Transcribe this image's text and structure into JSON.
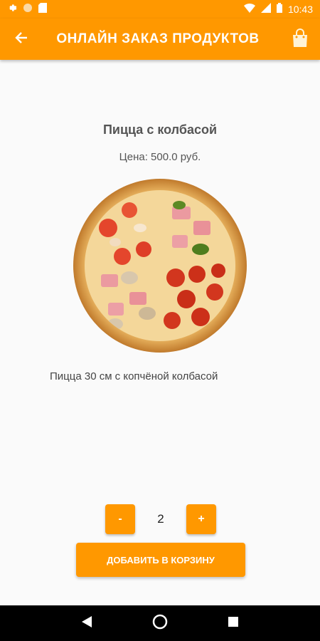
{
  "status_bar": {
    "time": "10:43",
    "icons": [
      "settings-icon",
      "circle-icon",
      "sd-card-icon",
      "wifi-icon",
      "signal-icon",
      "battery-icon"
    ]
  },
  "app_bar": {
    "title": "ОНЛАЙН ЗАКАЗ ПРОДУКТОВ",
    "back_icon": "arrow-back-icon",
    "cart_icon": "shopping-bag-icon",
    "color": "#ff9800"
  },
  "product": {
    "title": "Пицца с колбасой",
    "price": "Цена: 500.0 руб.",
    "description": "Пицца 30 см с копчёной колбасой",
    "image": "pizza-image"
  },
  "quantity": {
    "minus_label": "-",
    "value": "2",
    "plus_label": "+"
  },
  "add_to_cart": {
    "label": "ДОБАВИТЬ В КОРЗИНУ"
  },
  "nav_bar": {
    "icons": [
      "back-triangle-icon",
      "home-circle-icon",
      "recents-square-icon"
    ]
  },
  "colors": {
    "accent": "#ff9800",
    "background": "#fafafa",
    "text": "#555555"
  }
}
